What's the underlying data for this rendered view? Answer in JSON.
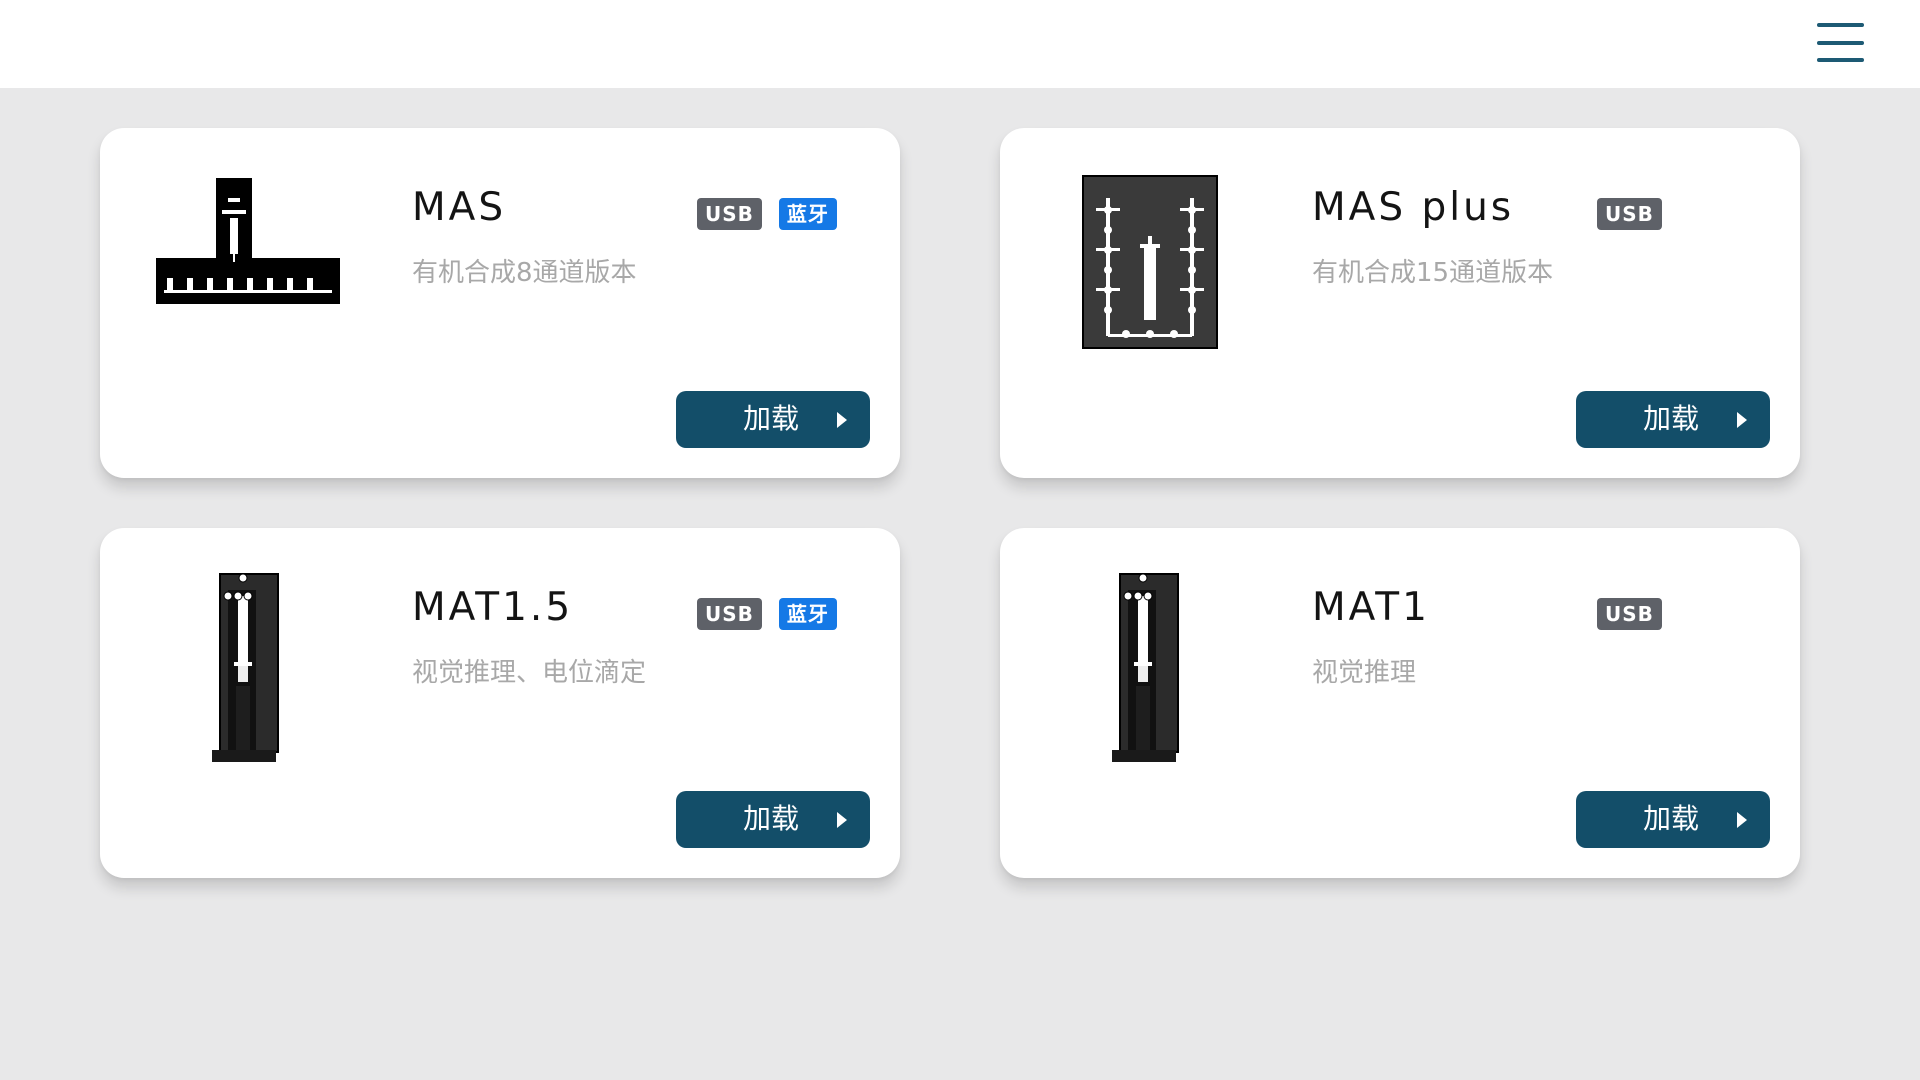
{
  "header": {
    "menu_icon": "hamburger-menu-icon",
    "menu_color": "#1d5a74"
  },
  "devices": [
    {
      "name": "MAS",
      "description": "有机合成8通道版本",
      "badges": [
        {
          "label": "USB",
          "color": "#5e6168"
        },
        {
          "label": "蓝牙",
          "color": "#1579e6"
        }
      ],
      "load_label": "加载",
      "icon": "mas-device-icon"
    },
    {
      "name": "MAS plus",
      "description": "有机合成15通道版本",
      "badges": [
        {
          "label": "USB",
          "color": "#5e6168"
        }
      ],
      "load_label": "加载",
      "icon": "mas-plus-device-icon"
    },
    {
      "name": "MAT1.5",
      "description": "视觉推理、电位滴定",
      "badges": [
        {
          "label": "USB",
          "color": "#5e6168"
        },
        {
          "label": "蓝牙",
          "color": "#1579e6"
        }
      ],
      "load_label": "加载",
      "icon": "mat15-device-icon"
    },
    {
      "name": "MAT1",
      "description": "视觉推理",
      "badges": [
        {
          "label": "USB",
          "color": "#5e6168"
        }
      ],
      "load_label": "加载",
      "icon": "mat1-device-icon"
    }
  ],
  "colors": {
    "button": "#134e69",
    "background": "#e8e8e9",
    "card": "#ffffff"
  }
}
